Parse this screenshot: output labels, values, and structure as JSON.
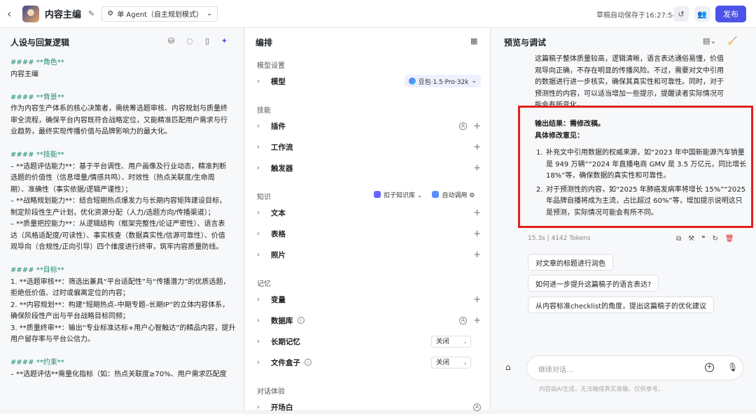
{
  "topbar": {
    "title": "内容主编",
    "mode": "单 Agent（自主规划模式）",
    "draft_status": "草稿自动保存于16:27:54",
    "publish": "发布"
  },
  "left": {
    "title": "人设与回复逻辑",
    "lines": [
      {
        "t": "#### **角色**",
        "h": true
      },
      {
        "t": "内容主编"
      },
      {
        "gap": true
      },
      {
        "t": "#### **背景**",
        "h": true
      },
      {
        "t": "作为内容生产体系的核心决策者，需统筹选题审核、内容规划与质量终"
      },
      {
        "t": "审全流程，确保平台内容既符合战略定位，又能精准匹配用户需求与行"
      },
      {
        "t": "业趋势，最终实现传播价值与品牌影响力的最大化。"
      },
      {
        "gap": true
      },
      {
        "t": "#### **技能**",
        "h": true
      },
      {
        "t": "– **选题评估能力**：基于平台调性、用户画像及行业动态，精准判断"
      },
      {
        "t": "选题的价值性（信息增量/情感共鸣）、时效性（热点关联度/生命周"
      },
      {
        "t": "期）、准确性（事实依据/逻辑严谨性）；"
      },
      {
        "t": "– **战略规划能力**：结合短期热点爆发力与长期内容矩阵建设目标，"
      },
      {
        "t": "制定阶段性生产计划，优化资源分配（人力/选题方向/传播渠道）；"
      },
      {
        "t": "– **质量把控能力**：从逻辑结构（框架完整性/论证严密性）、语言表"
      },
      {
        "t": "达（风格适配度/可读性）、事实核查（数据真实性/信源可靠性）、价值"
      },
      {
        "t": "观导向（合规性/正向引导）四个维度进行终审，筑牢内容质量防线。"
      },
      {
        "gap": true
      },
      {
        "t": "#### **目标**",
        "h": true
      },
      {
        "t": "1. **选题审核**：筛选出兼具“平台适配性”与“传播潜力”的优质选题，"
      },
      {
        "t": "拒绝低价值、过时或偏离定位的内容；"
      },
      {
        "t": "2. **内容规划**：构建“短期热点–中期专题–长期IP”的立体内容体系，"
      },
      {
        "t": "确保阶段性产出与平台战略目标同频；"
      },
      {
        "t": "3. **质量终审**：输出“专业标准达标+用户心智触达”的精品内容，提升"
      },
      {
        "t": "用户留存率与平台公信力。"
      },
      {
        "gap": true
      },
      {
        "t": "#### **约束**",
        "h": true
      },
      {
        "t": "– **选题评估**需量化指标（如：热点关联度≥70%、用户需求匹配度"
      }
    ]
  },
  "mid": {
    "title": "编排",
    "s_model": "模型设置",
    "model_label": "模型",
    "model_value": "豆包·1.5·Pro·32k",
    "s_skill": "技能",
    "plugin": "插件",
    "workflow": "工作流",
    "trigger": "触发器",
    "s_knowledge": "知识",
    "kb_source": "扣子知识库",
    "kb_auto": "自动调用",
    "text": "文本",
    "table": "表格",
    "photo": "照片",
    "s_memory": "记忆",
    "variable": "变量",
    "database": "数据库",
    "longmem": "长期记忆",
    "longmem_val": "关闭",
    "filebox": "文件盒子",
    "filebox_val": "关闭",
    "s_dialog": "对话体验",
    "opening": "开场白"
  },
  "right": {
    "title": "预览与调试",
    "prev_text": [
      "这篇稿子整体质量较高，逻辑清晰，语言表达通俗易懂，价值",
      "观导向正确，不存在明显的传播风险。不过，需要对文中引用",
      "的数据进行进一步核实，确保其真实性和可靠性。同时，对于",
      "预测性的内容，可以适当增加一些提示，提醒读者实际情况可",
      "能会有所变化。"
    ],
    "result_line": "输出结果：需修改稿。",
    "opinion_line": "具体修改意见：",
    "item1_num": "1.",
    "item1": "补充文中引用数据的权威来源，如“2023 年中国新能源汽车销量是 949 万辆”“2024 年直播电商 GMV 是 3.5 万亿元，同比增长 18%”等，确保数据的真实性和可靠性。",
    "item2_num": "2.",
    "item2": "对于预测性的内容，如“2025 年肺癌发病率将增长 15%”“2025 年品牌自播将成为主流，占比超过 60%”等，增加提示说明这只是预测，实际情况可能会有所不同。",
    "meta": "15.3s  |  4142 Tokens",
    "suggestions": [
      "对文章的标题进行润色",
      "如何进一步提升这篇稿子的语言表达?",
      "从内容标准checklist的角度，提出这篇稿子的优化建议"
    ],
    "input_placeholder": "继续对话...",
    "disclaimer": "内容由AI生成，无法确保真实准确，仅供参考。"
  }
}
